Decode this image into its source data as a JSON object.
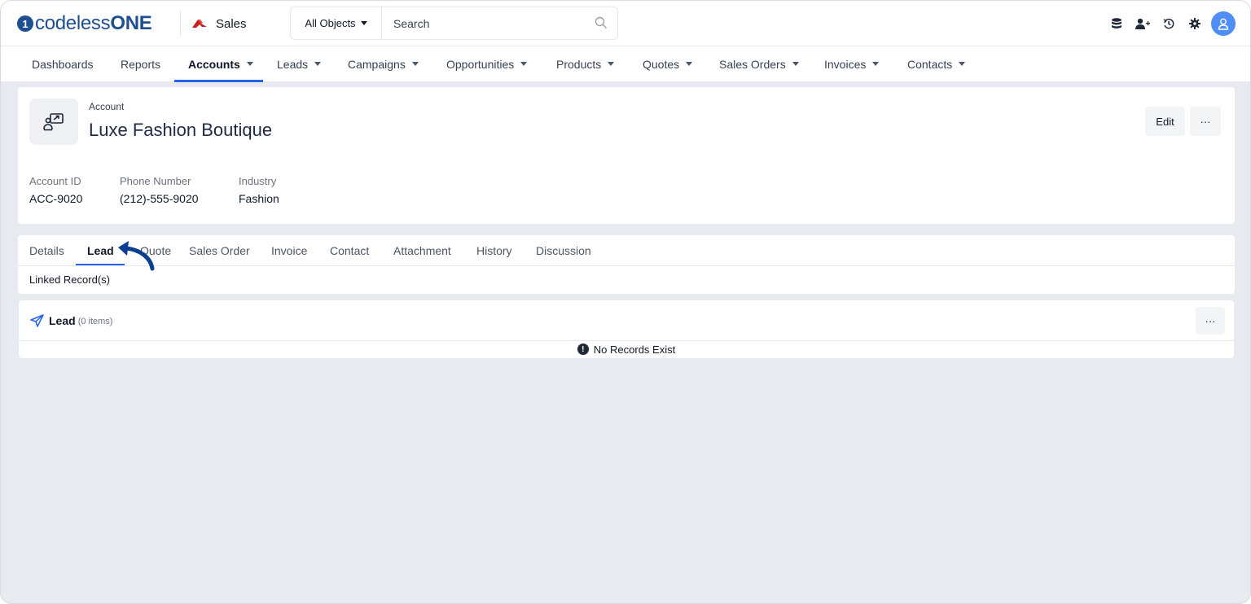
{
  "header": {
    "logo_mark": "1",
    "logo_text_prefix": "codeless",
    "logo_text_suffix": "ONE",
    "app_name": "Sales",
    "search_scope": "All Objects",
    "search_placeholder": "Search",
    "icons": [
      "database-icon",
      "add-user-icon",
      "history-icon",
      "settings-icon",
      "user-avatar-icon"
    ]
  },
  "nav": {
    "items": [
      {
        "label": "Dashboards",
        "has_menu": false
      },
      {
        "label": "Reports",
        "has_menu": false
      },
      {
        "label": "Accounts",
        "has_menu": true,
        "active": true
      },
      {
        "label": "Leads",
        "has_menu": true
      },
      {
        "label": "Campaigns",
        "has_menu": true
      },
      {
        "label": "Opportunities",
        "has_menu": true
      },
      {
        "label": "Products",
        "has_menu": true
      },
      {
        "label": "Quotes",
        "has_menu": true
      },
      {
        "label": "Sales Orders",
        "has_menu": true
      },
      {
        "label": "Invoices",
        "has_menu": true
      },
      {
        "label": "Contacts",
        "has_menu": true
      }
    ]
  },
  "record": {
    "type_label": "Account",
    "name": "Luxe Fashion Boutique",
    "edit_label": "Edit",
    "more_label": "···",
    "fields": [
      {
        "label": "Account ID",
        "value": "ACC-9020"
      },
      {
        "label": "Phone Number",
        "value": "(212)-555-9020"
      },
      {
        "label": "Industry",
        "value": "Fashion"
      }
    ]
  },
  "tabs": {
    "items": [
      "Details",
      "Lead",
      "Quote",
      "Sales Order",
      "Invoice",
      "Contact",
      "Attachment",
      "History",
      "Discussion"
    ],
    "active": "Lead",
    "linked_label": "Linked Record(s)"
  },
  "lead_section": {
    "title": "Lead",
    "count_text": "(0 items)",
    "more_label": "···",
    "empty_text": "No Records Exist"
  },
  "colors": {
    "brand": "#1d4f91",
    "accent": "#2563eb",
    "app_icon": "#c81e1e",
    "avatar": "#4f8ef7",
    "page_bg": "#e7eaee",
    "pointer_arrow": "#0b3d91"
  }
}
